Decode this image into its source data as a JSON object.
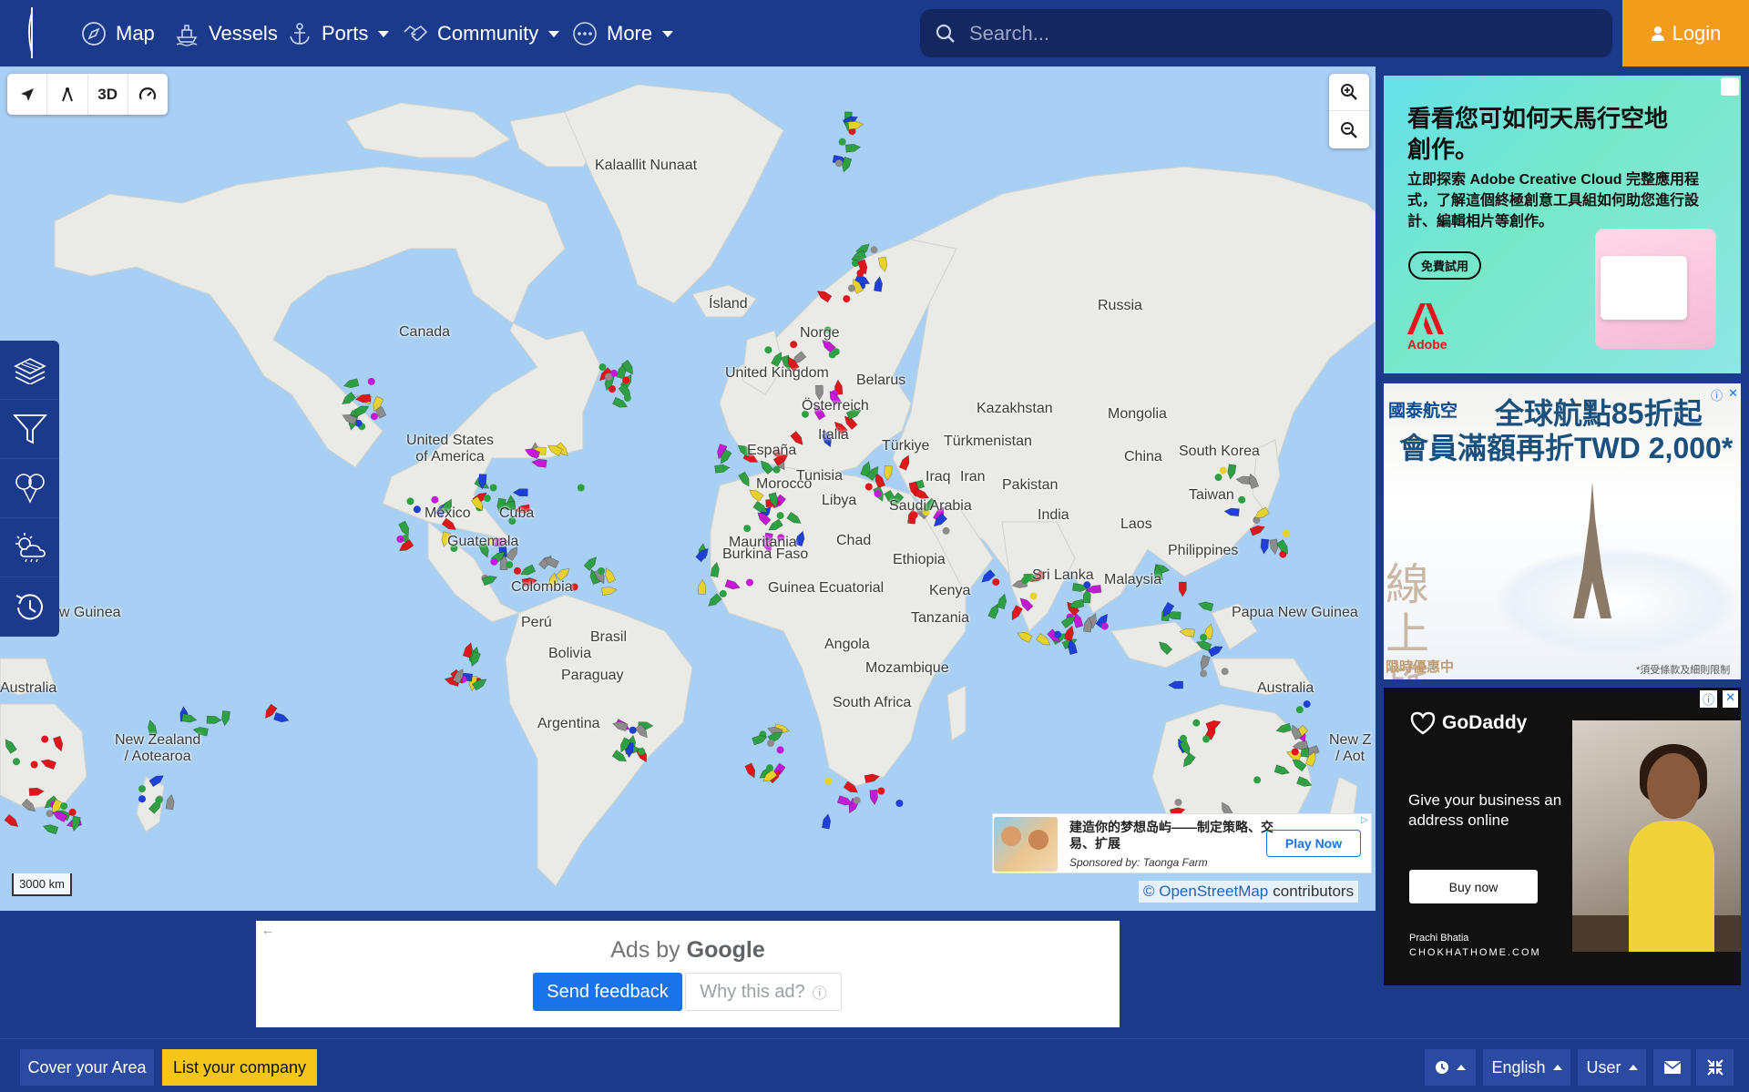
{
  "nav": {
    "items": [
      {
        "label": "Map",
        "icon": "compass-icon",
        "dropdown": false
      },
      {
        "label": "Vessels",
        "icon": "ship-icon",
        "dropdown": false
      },
      {
        "label": "Ports",
        "icon": "anchor-icon",
        "dropdown": true
      },
      {
        "label": "Community",
        "icon": "handshake-icon",
        "dropdown": true
      },
      {
        "label": "More",
        "icon": "more-icon",
        "dropdown": true
      }
    ],
    "search_placeholder": "Search...",
    "login_label": "Login",
    "accent_color": "#f39c1b",
    "bar_color": "#1b3a8c"
  },
  "map": {
    "toolbar": {
      "mode_3d_label": "3D"
    },
    "scale_label": "3000 km",
    "attribution_link": "© OpenStreetMap",
    "attribution_suffix": "contributors",
    "labels": [
      {
        "text": "Kalaallit Nunaat"
      },
      {
        "text": "Ísland"
      },
      {
        "text": "Canada"
      },
      {
        "text": "Russia"
      },
      {
        "text": "United Kingdom"
      },
      {
        "text": "Norge"
      },
      {
        "text": "Belarus"
      },
      {
        "text": "Österreich"
      },
      {
        "text": "Kazakhstan"
      },
      {
        "text": "Mongolia"
      },
      {
        "text": "United States\nof America"
      },
      {
        "text": "España"
      },
      {
        "text": "Italia"
      },
      {
        "text": "Türkiye"
      },
      {
        "text": "Türkmenistan"
      },
      {
        "text": "China"
      },
      {
        "text": "South Korea"
      },
      {
        "text": "Morocco"
      },
      {
        "text": "Tunisia"
      },
      {
        "text": "Iraq"
      },
      {
        "text": "Iran"
      },
      {
        "text": "Pakistan"
      },
      {
        "text": "México"
      },
      {
        "text": "Cuba"
      },
      {
        "text": "Libya"
      },
      {
        "text": "Saudi Arabia"
      },
      {
        "text": "India"
      },
      {
        "text": "Taiwan"
      },
      {
        "text": "Laos"
      },
      {
        "text": "Guatemala"
      },
      {
        "text": "Mauritania"
      },
      {
        "text": "Chad"
      },
      {
        "text": "Burkina Faso"
      },
      {
        "text": "Ethiopia"
      },
      {
        "text": "Philippines"
      },
      {
        "text": "Sri Lanka"
      },
      {
        "text": "Malaysia"
      },
      {
        "text": "Colombia"
      },
      {
        "text": "Guinea Ecuatorial"
      },
      {
        "text": "Kenya"
      },
      {
        "text": "Papua New Guinea"
      },
      {
        "text": "ew Guinea"
      },
      {
        "text": "Perú"
      },
      {
        "text": "Tanzania"
      },
      {
        "text": "Brasil"
      },
      {
        "text": "Angola"
      },
      {
        "text": "Bolivia"
      },
      {
        "text": "Mozambique"
      },
      {
        "text": "Paraguay"
      },
      {
        "text": "Australia"
      },
      {
        "text": "Australia"
      },
      {
        "text": "South Africa"
      },
      {
        "text": "Argentina"
      },
      {
        "text": "New Zealand\n/ Aotearoa"
      },
      {
        "text": "New Z\n/ Aot"
      }
    ],
    "legend_colors": {
      "cargo": "#2ea043",
      "tanker": "#e0161c",
      "passenger": "#1e3fd8",
      "pleasure": "#c41ad6",
      "fishing": "#e8d22a",
      "unknown": "#8c8c8c"
    },
    "ad": {
      "title": "建造你的梦想岛屿——制定策略、交易、扩展",
      "sponsor": "Sponsored by: Taonga Farm",
      "cta": "Play Now"
    }
  },
  "side_panel": {
    "buttons": [
      "layers-icon",
      "filter-icon",
      "balloons-icon",
      "weather-icon",
      "history-icon"
    ]
  },
  "right_ads": {
    "adobe": {
      "headline": "看看您可如何天馬行空地創作。",
      "body": "立即探索 Adobe Creative Cloud 完整應用程式，了解這個終極創意工具組如何助您進行設計、編輯相片等創作。",
      "cta": "免費試用",
      "brand": "Adobe"
    },
    "eva": {
      "brand": "國泰航空",
      "headline1": "全球航點85折起",
      "headline2": "會員滿額再折TWD 2,000*",
      "big_text": "線上旅展",
      "sub_text": "限時優惠中",
      "fine_print": "*須受條款及細則限制"
    },
    "godaddy": {
      "brand": "GoDaddy",
      "tagline": "Give your business an address online",
      "cta": "Buy now",
      "person": "Prachi Bhatia",
      "site": "CHOKHATHOME.COM"
    }
  },
  "bottom_ad": {
    "ads_by": "Ads by",
    "google": "Google",
    "send_feedback": "Send feedback",
    "why_ad": "Why this ad?"
  },
  "footer": {
    "cover_area": "Cover your Area",
    "list_company": "List your company",
    "language": "English",
    "user": "User"
  }
}
